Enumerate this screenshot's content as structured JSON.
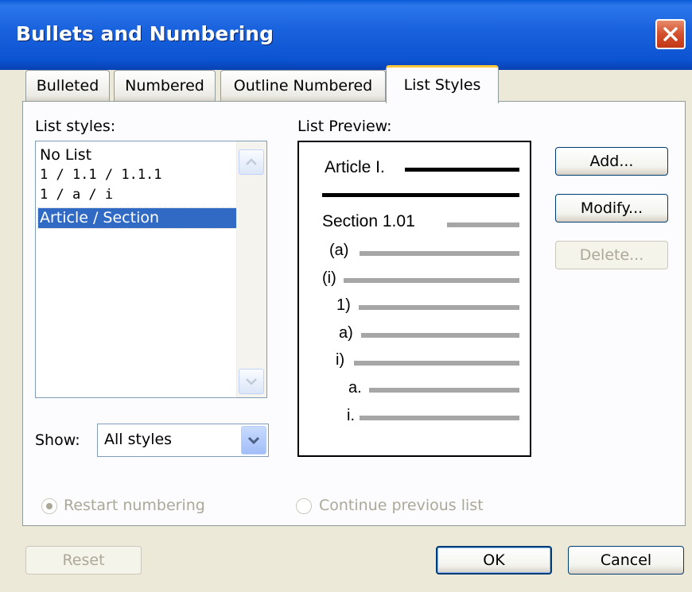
{
  "window": {
    "title": "Bullets and Numbering"
  },
  "tabs": [
    {
      "label": "Bulleted"
    },
    {
      "label": "Numbered"
    },
    {
      "label": "Outline Numbered"
    },
    {
      "label": "List Styles"
    }
  ],
  "active_tab": "List Styles",
  "list_styles": {
    "label": "List styles:",
    "items": [
      {
        "label": "No List"
      },
      {
        "label": "1 / 1.1 / 1.1.1"
      },
      {
        "label": "1 / a / i"
      },
      {
        "label": "Article / Section"
      }
    ],
    "selected": "Article / Section"
  },
  "preview": {
    "label": "List Preview:",
    "lines": [
      {
        "label": "Article I."
      },
      {
        "label": ""
      },
      {
        "label": "Section 1.01"
      },
      {
        "label": "(a)"
      },
      {
        "label": "(i)"
      },
      {
        "label": "1)"
      },
      {
        "label": "a)"
      },
      {
        "label": "i)"
      },
      {
        "label": "a."
      },
      {
        "label": "i."
      }
    ]
  },
  "show": {
    "label": "Show:",
    "value": "All styles"
  },
  "buttons": {
    "add": "Add...",
    "modify": "Modify...",
    "delete": "Delete...",
    "reset": "Reset",
    "ok": "OK",
    "cancel": "Cancel"
  },
  "radios": {
    "restart": {
      "label": "Restart numbering",
      "checked": true
    },
    "continue": {
      "label": "Continue previous list",
      "checked": false
    }
  },
  "colors": {
    "titlebar": "#0a5bd6",
    "selection": "#316ac5",
    "face": "#ece9d8",
    "close": "#d2502e"
  },
  "icons": {
    "close": "close-icon",
    "scroll_up": "chevron-up-icon",
    "scroll_down": "chevron-down-icon",
    "dropdown": "chevron-down-icon"
  }
}
